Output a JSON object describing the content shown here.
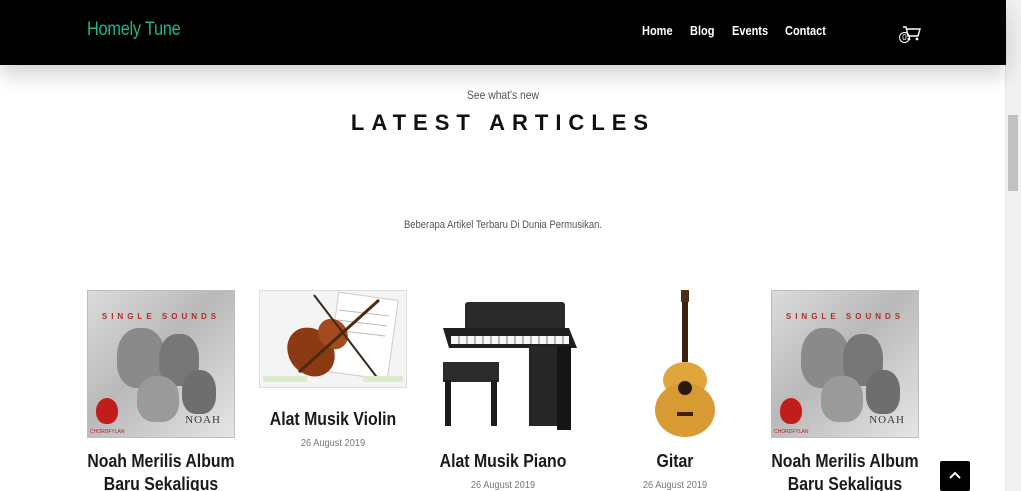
{
  "header": {
    "brand": "Homely Tune",
    "nav": [
      "Home",
      "Blog",
      "Events",
      "Contact"
    ],
    "cart_count": "0"
  },
  "section": {
    "eyebrow": "See what's new",
    "title": "LATEST ARTICLES",
    "description": "Beberapa Artikel Terbaru Di Dunia Permusikan."
  },
  "articles": [
    {
      "title_line1": "Noah Merilis Album",
      "title_line2": "Baru Sekaligus",
      "date": "",
      "image": "album-cover-noah"
    },
    {
      "title_line1": "Alat Musik Violin",
      "title_line2": "",
      "date": "26 August 2019",
      "image": "violin"
    },
    {
      "title_line1": "Alat Musik Piano",
      "title_line2": "",
      "date": "26 August 2019",
      "image": "piano"
    },
    {
      "title_line1": "Gitar",
      "title_line2": "",
      "date": "26 August 2019",
      "image": "acoustic-guitar"
    },
    {
      "title_line1": "Noah Merilis Album",
      "title_line2": "Baru Sekaligus",
      "date": "",
      "image": "album-cover-noah"
    }
  ],
  "album": {
    "band": "NOAH",
    "tagline": "SINGLE SOUNDS",
    "label": "CHORDFYLAN"
  },
  "colors": {
    "brand": "#1fb58f",
    "header_bg": "#000000",
    "text": "#1a1a1a"
  }
}
